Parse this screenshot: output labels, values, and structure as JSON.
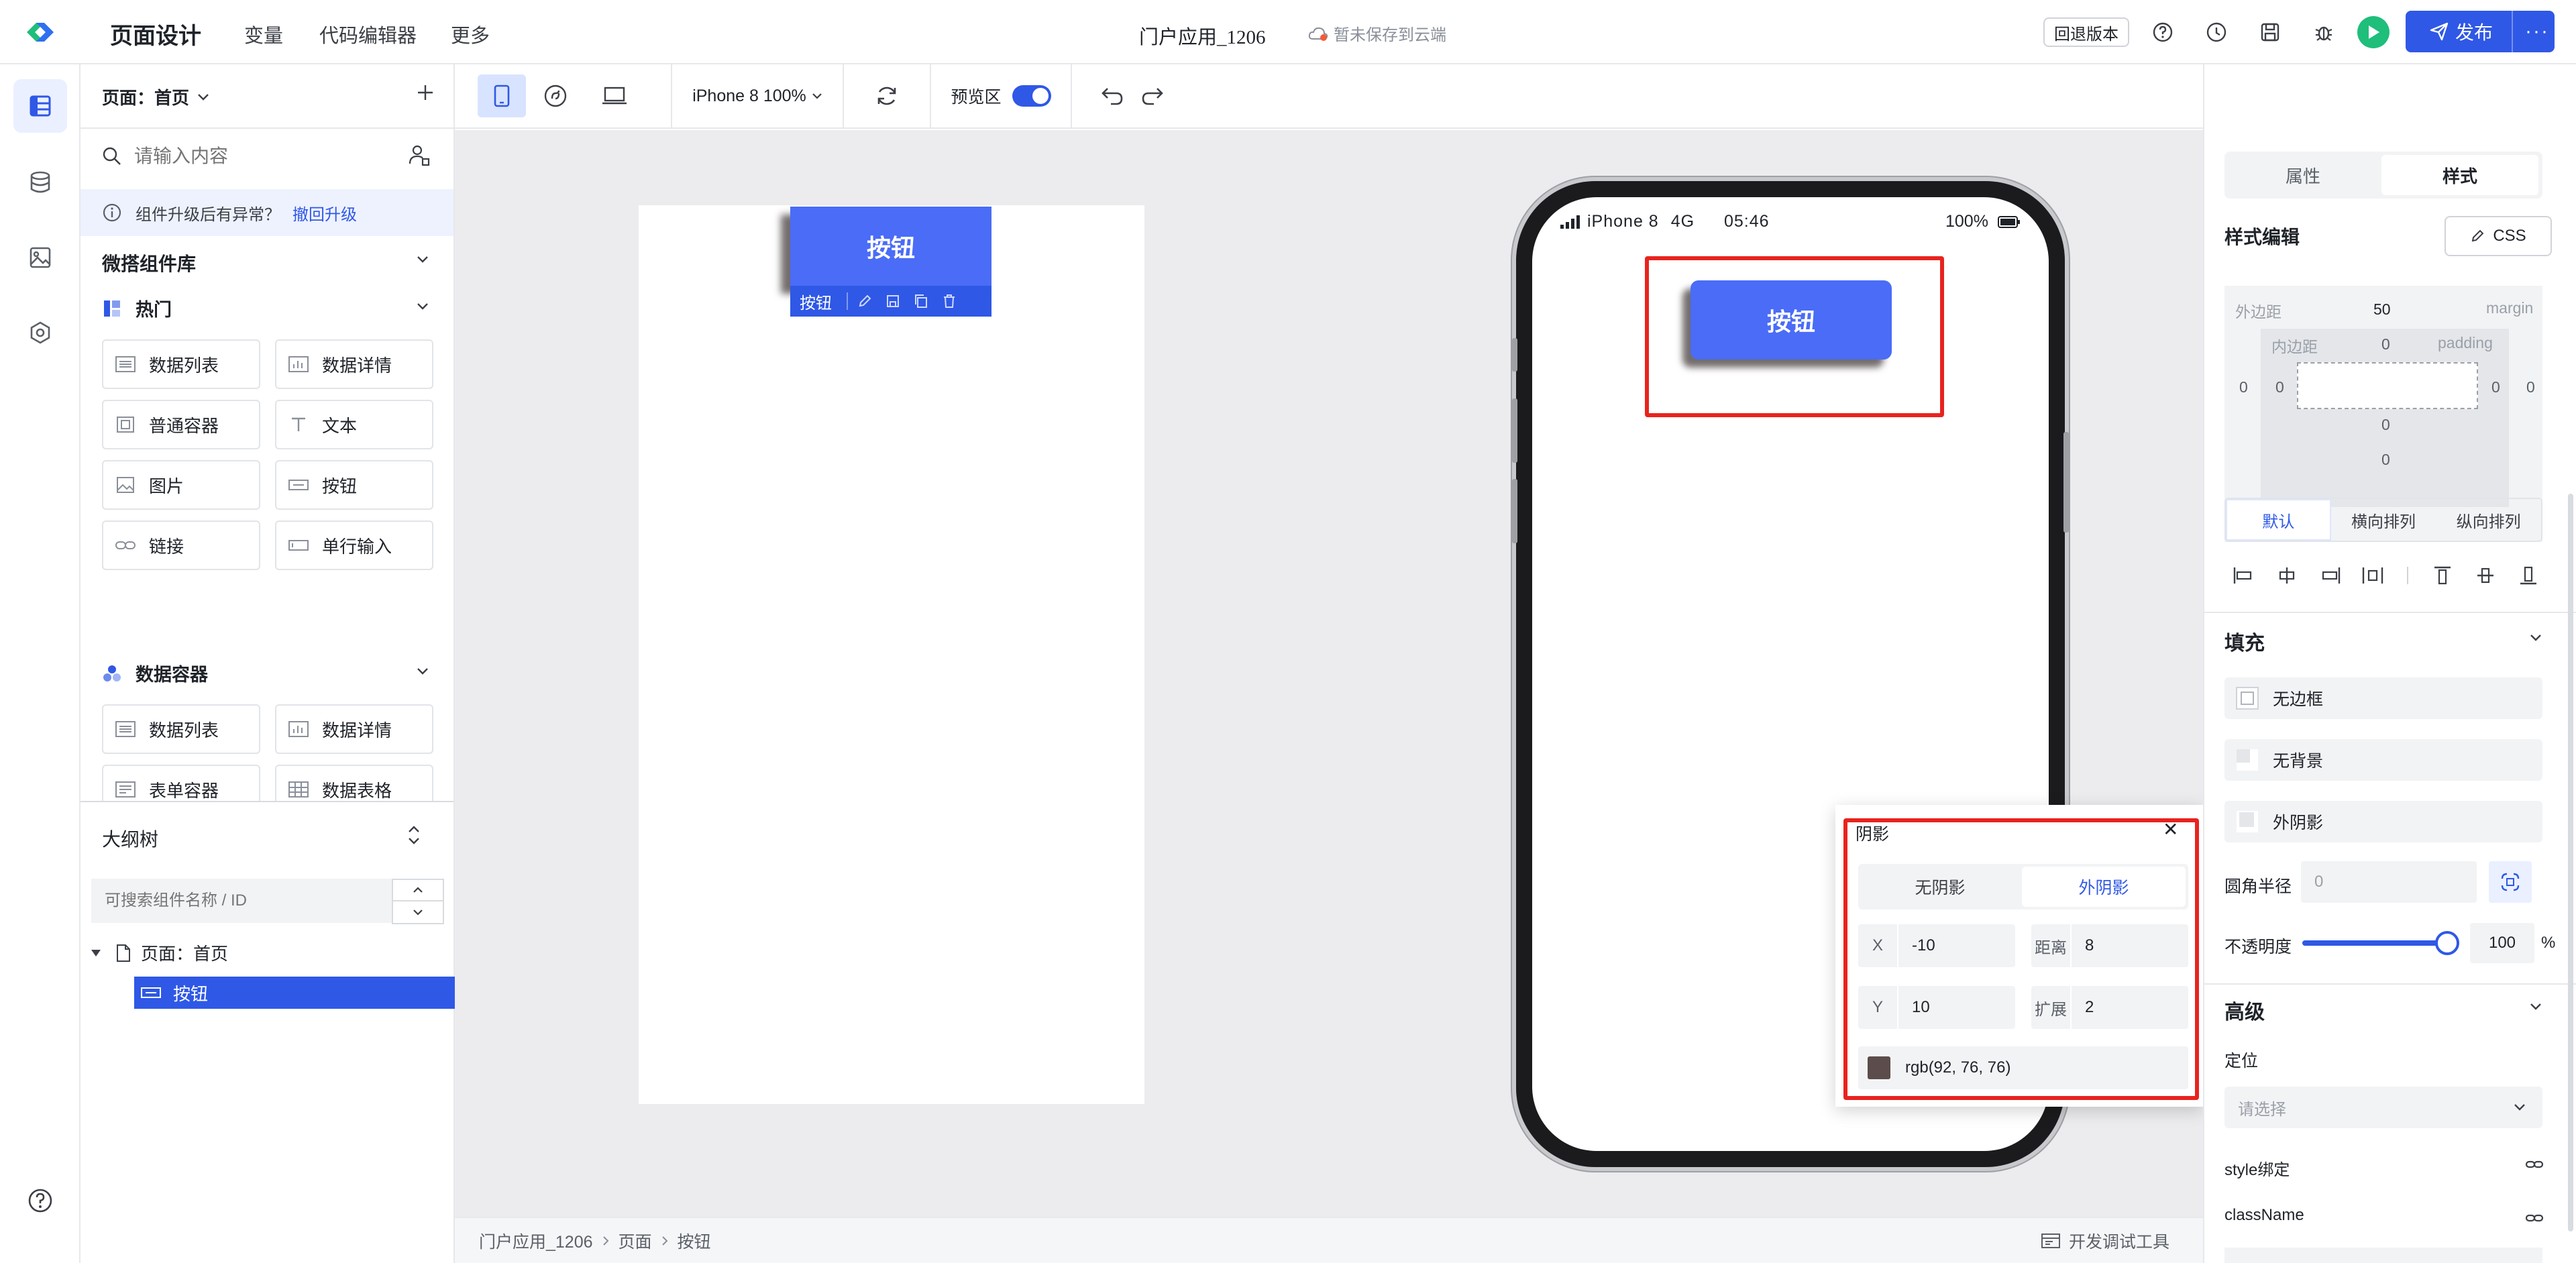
{
  "header": {
    "title": "页面设计",
    "menu": [
      "变量",
      "代码编辑器",
      "更多"
    ],
    "app_name": "门户应用_1206",
    "save_status": "暂未保存到云端",
    "rollback_label": "回退版本",
    "publish_label": "发布"
  },
  "left": {
    "page_select": "页面：首页",
    "search_placeholder": "请输入内容",
    "upgrade_notice": "组件升级后有异常？",
    "upgrade_undo": "撤回升级",
    "library_title": "微搭组件库",
    "groups": [
      {
        "title": "热门",
        "items": [
          "数据列表",
          "数据详情",
          "普通容器",
          "文本",
          "图片",
          "按钮",
          "链接",
          "单行输入"
        ]
      },
      {
        "title": "数据容器",
        "items": [
          "数据列表",
          "数据详情",
          "表单容器",
          "数据表格"
        ]
      }
    ],
    "outline_title": "大纲树",
    "outline_search_placeholder": "可搜索组件名称 / ID",
    "tree": {
      "root": "页面：首页",
      "child": "按钮"
    }
  },
  "toolbar": {
    "device": "iPhone 8 100%",
    "preview_label": "预览区",
    "preview_on": true
  },
  "canvas": {
    "button_label": "按钮",
    "selection_tag": "按钮",
    "phone_status": {
      "carrier": "iPhone 8",
      "network": "4G",
      "time": "05:46",
      "battery": "100%"
    },
    "phone_button_label": "按钮"
  },
  "shadow_popup": {
    "title": "阴影",
    "close": "✕",
    "tabs": [
      "无阴影",
      "外阴影"
    ],
    "active_tab": "外阴影",
    "x_label": "X",
    "x_value": "-10",
    "dist_label": "距离",
    "dist_value": "8",
    "y_label": "Y",
    "y_value": "10",
    "spread_label": "扩展",
    "spread_value": "2",
    "color_value": "rgb(92, 76, 76)",
    "color_hex": "#5c4c4c"
  },
  "right": {
    "tabs": [
      "属性",
      "样式"
    ],
    "active_tab": "样式",
    "style_edit_title": "样式编辑",
    "css_label": "CSS",
    "margin_label": "外边距",
    "margin_value": "50",
    "margin_en": "margin",
    "padding_label": "内边距",
    "padding_top": "0",
    "padding_en": "padding",
    "margin_left": "0",
    "padding_left": "0",
    "padding_right": "0",
    "margin_right": "0",
    "padding_bottom": "0",
    "margin_bottom": "0",
    "layout_tabs": [
      "默认",
      "横向排列",
      "纵向排列"
    ],
    "fill_title": "填充",
    "border_label": "无边框",
    "bg_label": "无背景",
    "shadow_label": "外阴影",
    "radius_label": "圆角半径",
    "radius_value": "0",
    "opacity_label": "不透明度",
    "opacity_value": "100",
    "opacity_unit": "%",
    "opacity_level": 1.0,
    "advanced_title": "高级",
    "position_label": "定位",
    "position_placeholder": "请选择",
    "style_bind_label": "style绑定",
    "classname_label": "className"
  },
  "statusbar": {
    "breadcrumb": [
      "门户应用_1206",
      "页面",
      "按钮"
    ],
    "devtools_label": "开发调试工具"
  },
  "colors": {
    "accent": "#2f58e6",
    "button": "#4a6cf7",
    "highlight": "#e8231e",
    "tree_selected": "#2f58e6"
  }
}
